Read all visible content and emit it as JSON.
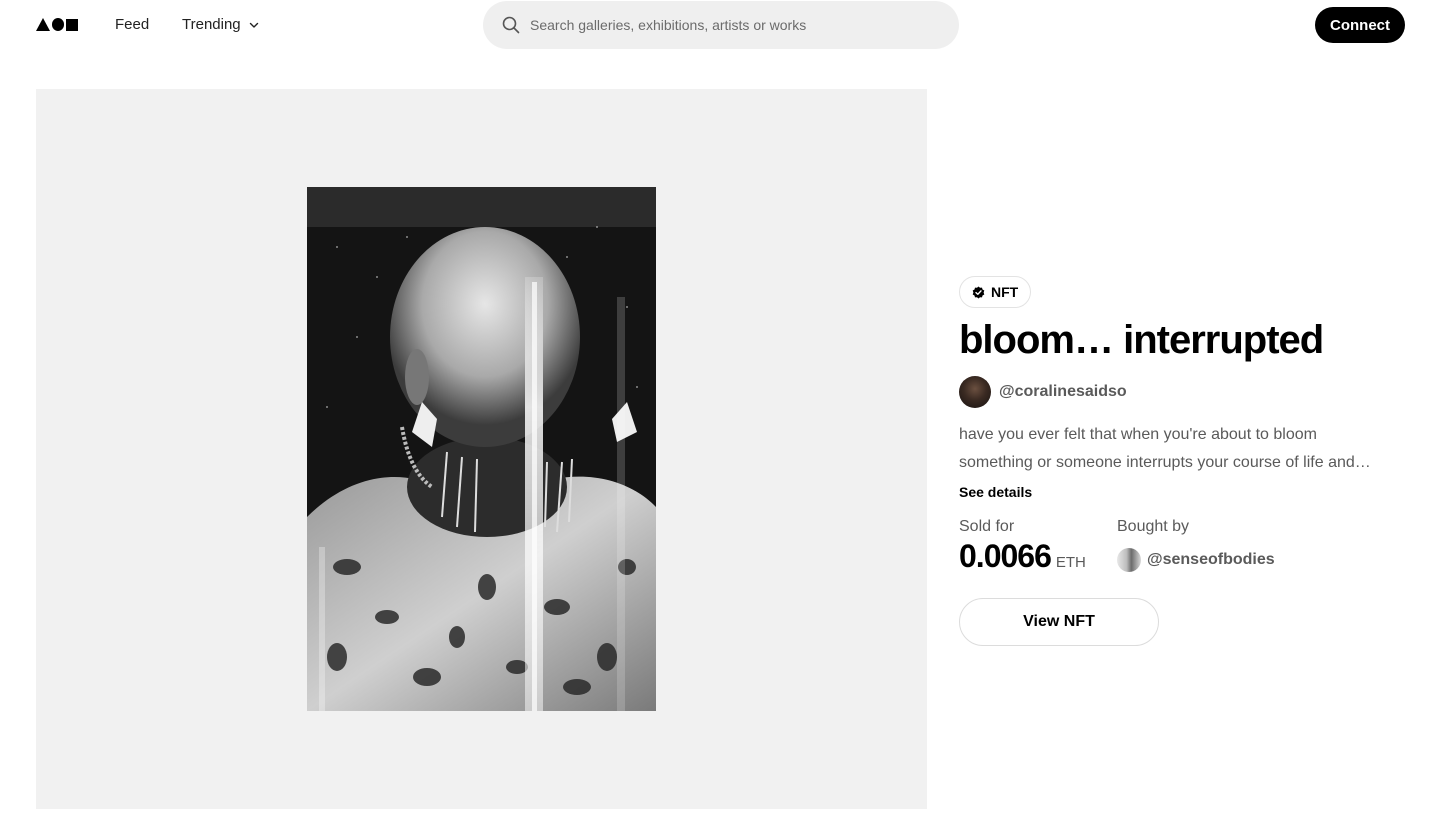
{
  "header": {
    "logo_icon": "aoi-logo-icon",
    "nav": {
      "feed_label": "Feed",
      "trending_label": "Trending",
      "trending_icon": "chevron-down-icon"
    },
    "search": {
      "icon": "search-icon",
      "placeholder": "Search galleries, exhibitions, artists or works",
      "value": ""
    },
    "connect_label": "Connect"
  },
  "artwork": {
    "description_icon": "artwork-image",
    "panel_color": "#f1f1f1"
  },
  "info": {
    "badge_label": "NFT",
    "badge_icon": "verified-check-icon",
    "title": "bloom… interrupted",
    "artist_handle": "@coralinesaidso",
    "description_line1": "have you ever felt that when you're about to bloom",
    "description_line2": "something or someone interrupts your course of life and…",
    "see_details_label": "See details",
    "sold_label": "Sold for",
    "price_value": "0.0066",
    "price_unit": "ETH",
    "bought_label": "Bought by",
    "buyer_handle": "@senseofbodies",
    "view_button_label": "View NFT"
  }
}
